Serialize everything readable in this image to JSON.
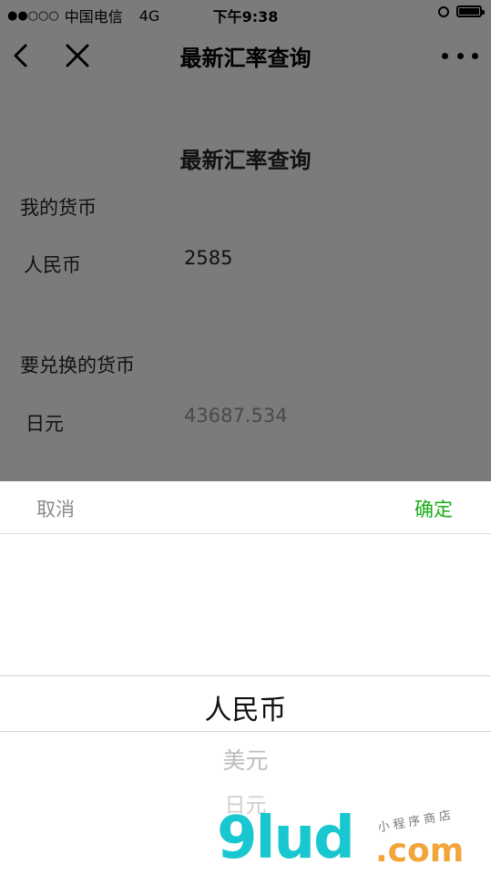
{
  "status_bar": {
    "signal_dots": "●●○○○",
    "carrier": "中国电信",
    "network": "4G",
    "time": "下午9:38"
  },
  "nav": {
    "title": "最新汇率查询",
    "back_icon": "chevron-left-icon",
    "close_icon": "close-icon",
    "more_icon": "more-horizontal-icon"
  },
  "page": {
    "title": "最新汇率查询",
    "my_currency_label": "我的货币",
    "my_currency_name": "人民币",
    "my_currency_amount": "2585",
    "target_label": "要兑换的货币",
    "target_currency_name": "日元",
    "target_currency_amount": "43687.534"
  },
  "picker": {
    "cancel_label": "取消",
    "confirm_label": "确定",
    "options": [
      "人民币",
      "美元",
      "日元"
    ],
    "selected": "人民币",
    "confirm_color": "#1aad19"
  },
  "watermark": {
    "brand_main": "9lud",
    "brand_domain": ".com",
    "brand_tagline": "小程序商店"
  }
}
